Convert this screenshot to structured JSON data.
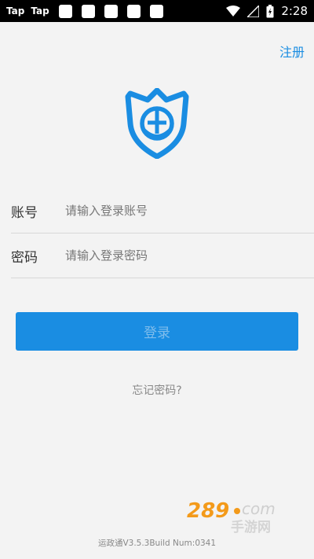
{
  "status_bar": {
    "left_labels": [
      "Tap",
      "Tap"
    ],
    "time": "2:28",
    "icons": [
      "wifi-icon",
      "signal-icon",
      "battery-icon"
    ]
  },
  "header": {
    "register_label": "注册"
  },
  "login_form": {
    "account": {
      "label": "账号",
      "placeholder": "请输入登录账号",
      "value": ""
    },
    "password": {
      "label": "密码",
      "placeholder": "请输入登录密码",
      "value": ""
    },
    "submit_label": "登录",
    "forgot_label": "忘记密码?"
  },
  "footer": {
    "version": "运政通V3.5.3Build Num:0341"
  },
  "watermark": {
    "text": "289.com 手游网"
  },
  "colors": {
    "accent": "#1a8de2",
    "background": "#f3f3f3"
  }
}
